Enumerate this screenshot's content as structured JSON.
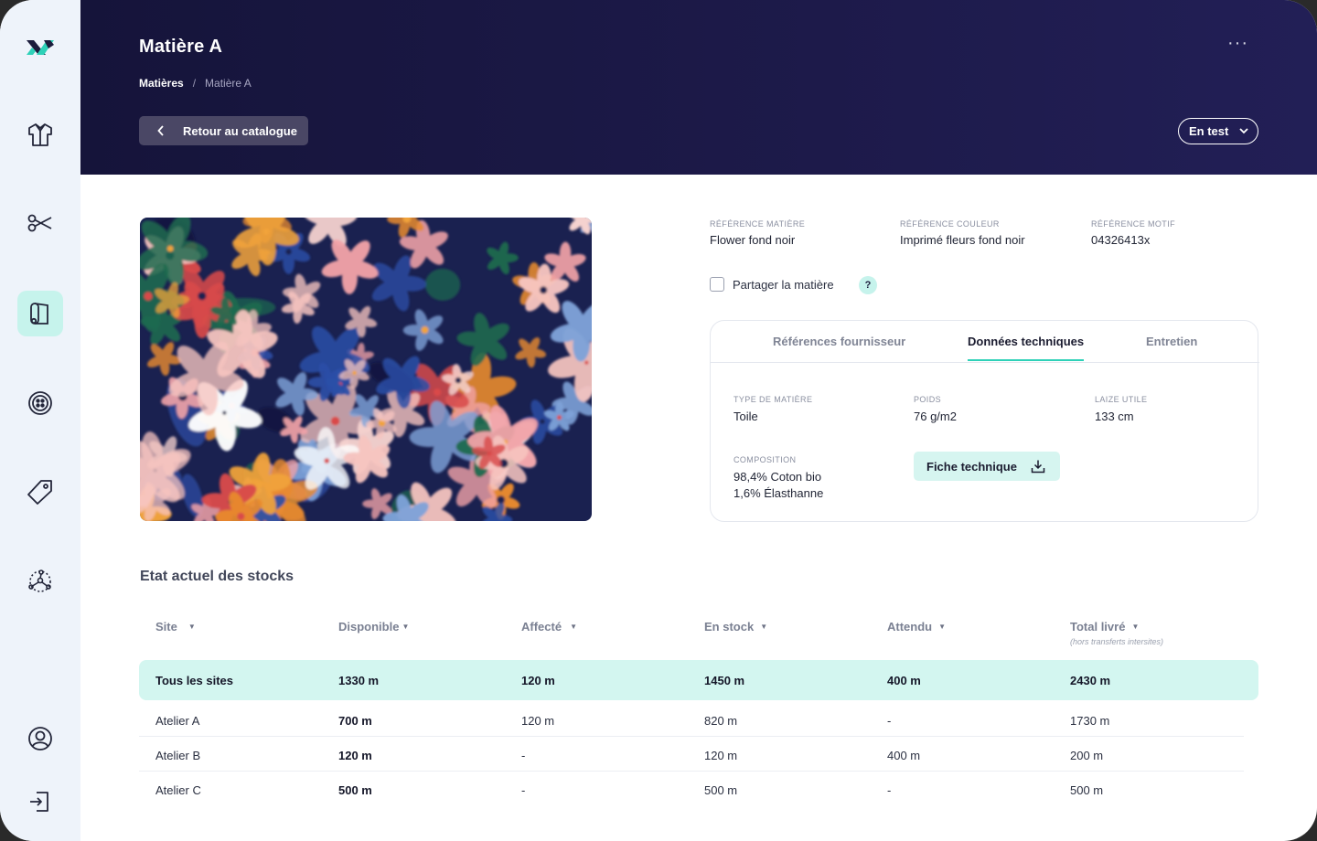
{
  "header": {
    "title": "Matière A",
    "more_label": "···",
    "breadcrumb": {
      "root": "Matières",
      "separator": "/",
      "current": "Matière A"
    },
    "back_label": "Retour au catalogue",
    "status_label": "En test"
  },
  "sidebar": {
    "items": [
      {
        "name": "logo"
      },
      {
        "name": "garment-icon"
      },
      {
        "name": "scissors-icon"
      },
      {
        "name": "fabric-roll-icon",
        "active": true
      },
      {
        "name": "button-icon"
      },
      {
        "name": "tag-icon"
      },
      {
        "name": "network-icon"
      },
      {
        "name": "user-icon"
      },
      {
        "name": "logout-icon"
      }
    ],
    "active_color": "#c6f3ec"
  },
  "references": {
    "matiere": {
      "label": "Référence matière",
      "value": "Flower fond noir"
    },
    "couleur": {
      "label": "Référence couleur",
      "value": "Imprimé fleurs fond noir"
    },
    "motif": {
      "label": "Référence motif",
      "value": "04326413x"
    }
  },
  "share": {
    "label": "Partager la matière",
    "checked": false,
    "help": "?"
  },
  "tabs": [
    {
      "label": "Références fournisseur",
      "active": false
    },
    {
      "label": "Données techniques",
      "active": true
    },
    {
      "label": "Entretien",
      "active": false
    }
  ],
  "technical": {
    "type": {
      "label": "Type de matière",
      "value": "Toile"
    },
    "poids": {
      "label": "Poids",
      "value": "76 g/m2"
    },
    "laize": {
      "label": "Laize utile",
      "value": "133 cm"
    },
    "composition": {
      "label": "Composition",
      "line1": "98,4% Coton bio",
      "line2": "1,6% Élasthanne"
    },
    "sheet_button": "Fiche technique"
  },
  "stocks": {
    "title": "Etat actuel des stocks",
    "columns": [
      "Site",
      "Disponible",
      "Affecté",
      "En stock",
      "Attendu",
      "Total livré"
    ],
    "column_note": "(hors transferts intersites)",
    "total": [
      "Tous les sites",
      "1330 m",
      "120 m",
      "1450 m",
      "400 m",
      "2430 m"
    ],
    "rows": [
      [
        "Atelier A",
        "700 m",
        "120 m",
        "820 m",
        "-",
        "1730 m"
      ],
      [
        "Atelier B",
        "120 m",
        "-",
        "120 m",
        "400 m",
        "200 m"
      ],
      [
        "Atelier C",
        "500 m",
        "-",
        "500 m",
        "-",
        "500 m"
      ]
    ]
  },
  "colors": {
    "header_bg": "#1b1845",
    "accent": "#2ed1b8",
    "total_row": "#d3f6f0"
  }
}
